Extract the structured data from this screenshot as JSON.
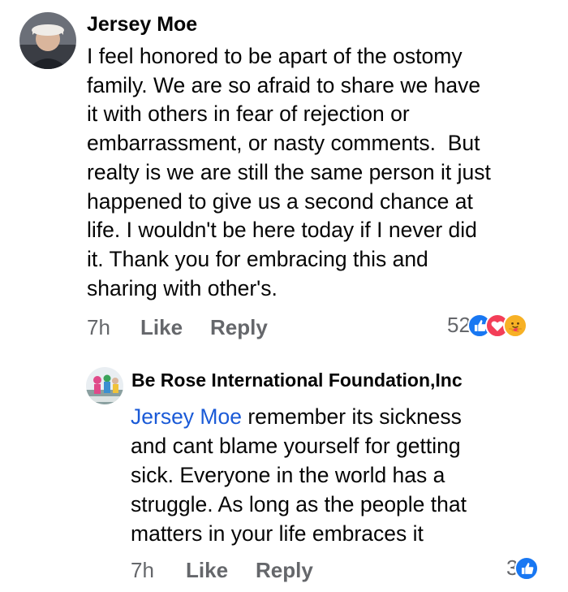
{
  "comment1": {
    "author": "Jersey Moe",
    "lines": [
      "I feel honored to be apart of the ostomy",
      "family. We are so afraid to share we have",
      "it with others in fear of rejection or",
      "embarrassment, or nasty comments.  But",
      "realty is we are still the same person it just",
      "happened to give us a second chance at",
      "life. I wouldn't be here today if I never did",
      "it. Thank you for embracing this and",
      "sharing with other's."
    ],
    "time": "7h",
    "like_label": "Like",
    "reply_label": "Reply",
    "reaction_count": "52",
    "reactions": [
      "like-reaction-icon",
      "love-reaction-icon",
      "care-reaction-icon"
    ]
  },
  "reply1": {
    "author": "Be Rose International Foundation,Inc",
    "mention": "Jersey Moe",
    "first_line_rest": " remember its sickness",
    "lines": [
      "and cant blame yourself for getting",
      "sick. Everyone in the world has a",
      "struggle. As long as the people that",
      "matters in your life embraces it"
    ],
    "time": "7h",
    "like_label": "Like",
    "reply_label": "Reply",
    "reaction_count": "3",
    "reactions": [
      "like-reaction-icon"
    ]
  },
  "colors": {
    "text": "#050505",
    "meta": "#65676b",
    "mention": "#1a5ad7",
    "like_blue": "#1877f2",
    "love_red": "#f33e58",
    "care_yellow": "#f7b125"
  }
}
